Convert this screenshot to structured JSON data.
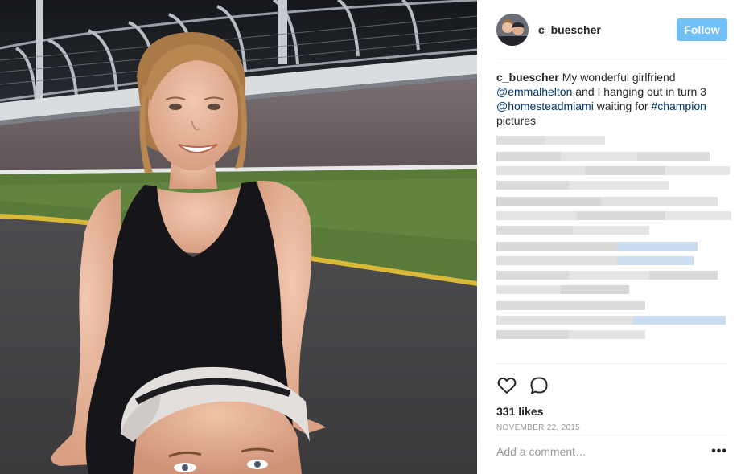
{
  "post": {
    "username": "c_buescher",
    "follow_label": "Follow",
    "caption": {
      "username": "c_buescher",
      "text_1": " My wonderful girlfriend ",
      "mention_1": "@emmalhelton",
      "text_2": " and I hanging out in turn 3 ",
      "mention_2": "@homesteadmiami",
      "text_3": " waiting for ",
      "hashtag": "#champion",
      "text_4": " pictures"
    },
    "likes": "331 likes",
    "date": "NOVEMBER 22, 2015",
    "comment_placeholder": "Add a comment…",
    "more_label": "•••"
  },
  "icons": {
    "like": "heart-icon",
    "comment": "comment-bubble-icon",
    "more": "more-options-icon"
  },
  "colors": {
    "follow_button": "#70c0f6",
    "link": "#003569",
    "muted": "#999999"
  }
}
